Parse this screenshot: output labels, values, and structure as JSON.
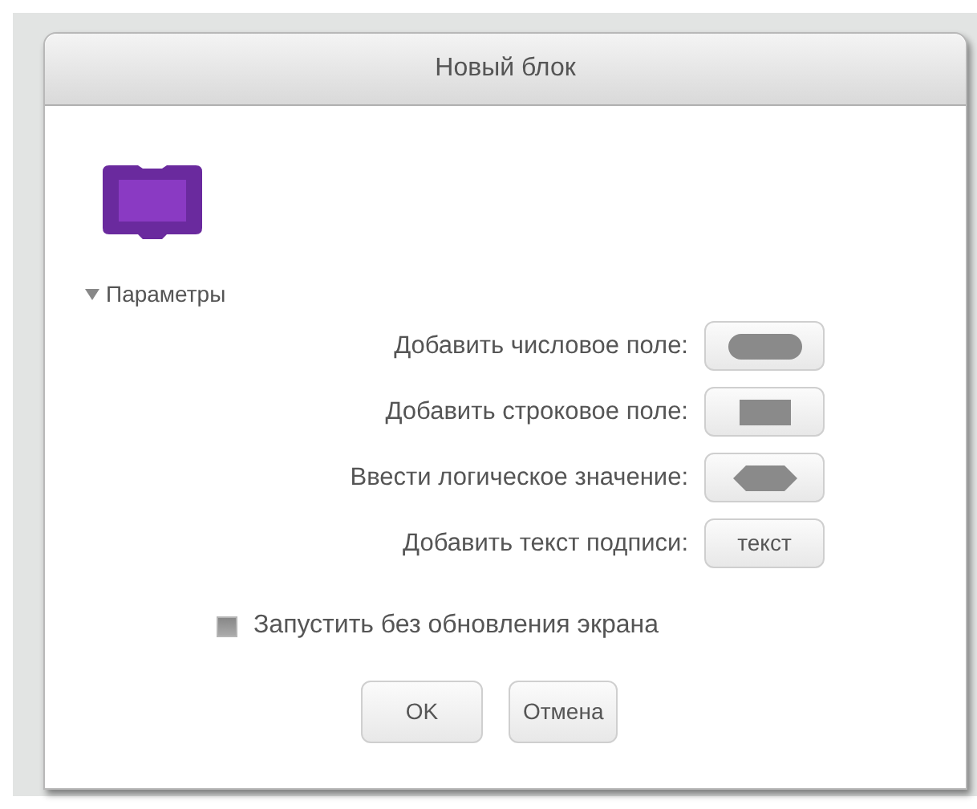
{
  "dialog": {
    "title": "Новый блок"
  },
  "options": {
    "label": "Параметры",
    "expanded": true,
    "rows": [
      {
        "label": "Добавить числовое поле:",
        "kind": "number"
      },
      {
        "label": "Добавить строковое поле:",
        "kind": "string"
      },
      {
        "label": "Ввести логическое значение:",
        "kind": "boolean"
      },
      {
        "label": "Добавить текст подписи:",
        "kind": "text",
        "button_text": "текст"
      }
    ],
    "checkbox": {
      "label": "Запустить без обновления экрана",
      "checked": false
    }
  },
  "buttons": [
    "OK",
    "Отмена"
  ]
}
